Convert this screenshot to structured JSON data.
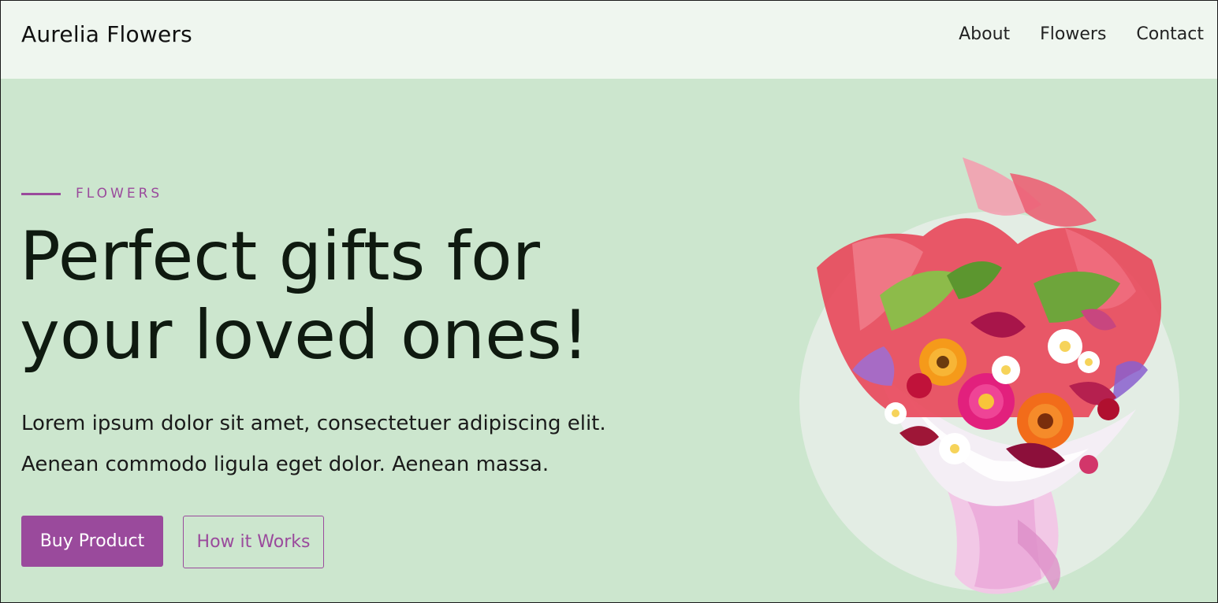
{
  "header": {
    "brand": "Aurelia Flowers",
    "nav": [
      {
        "label": "About"
      },
      {
        "label": "Flowers"
      },
      {
        "label": "Contact"
      }
    ]
  },
  "hero": {
    "eyebrow": "FLOWERS",
    "headline_line1": "Perfect gifts for",
    "headline_line2": "your loved ones!",
    "lead_line1": "Lorem ipsum dolor sit amet, consectetuer adipiscing elit.",
    "lead_line2": "Aenean commodo ligula eget dolor. Aenean massa.",
    "primary_button": "Buy Product",
    "secondary_button": "How it Works",
    "image_icon": "flower-bouquet-image"
  },
  "colors": {
    "accent": "#9a4a9c",
    "hero_background": "#cce6ce",
    "header_background": "#eff6ef",
    "circle": "#e3ede4"
  }
}
